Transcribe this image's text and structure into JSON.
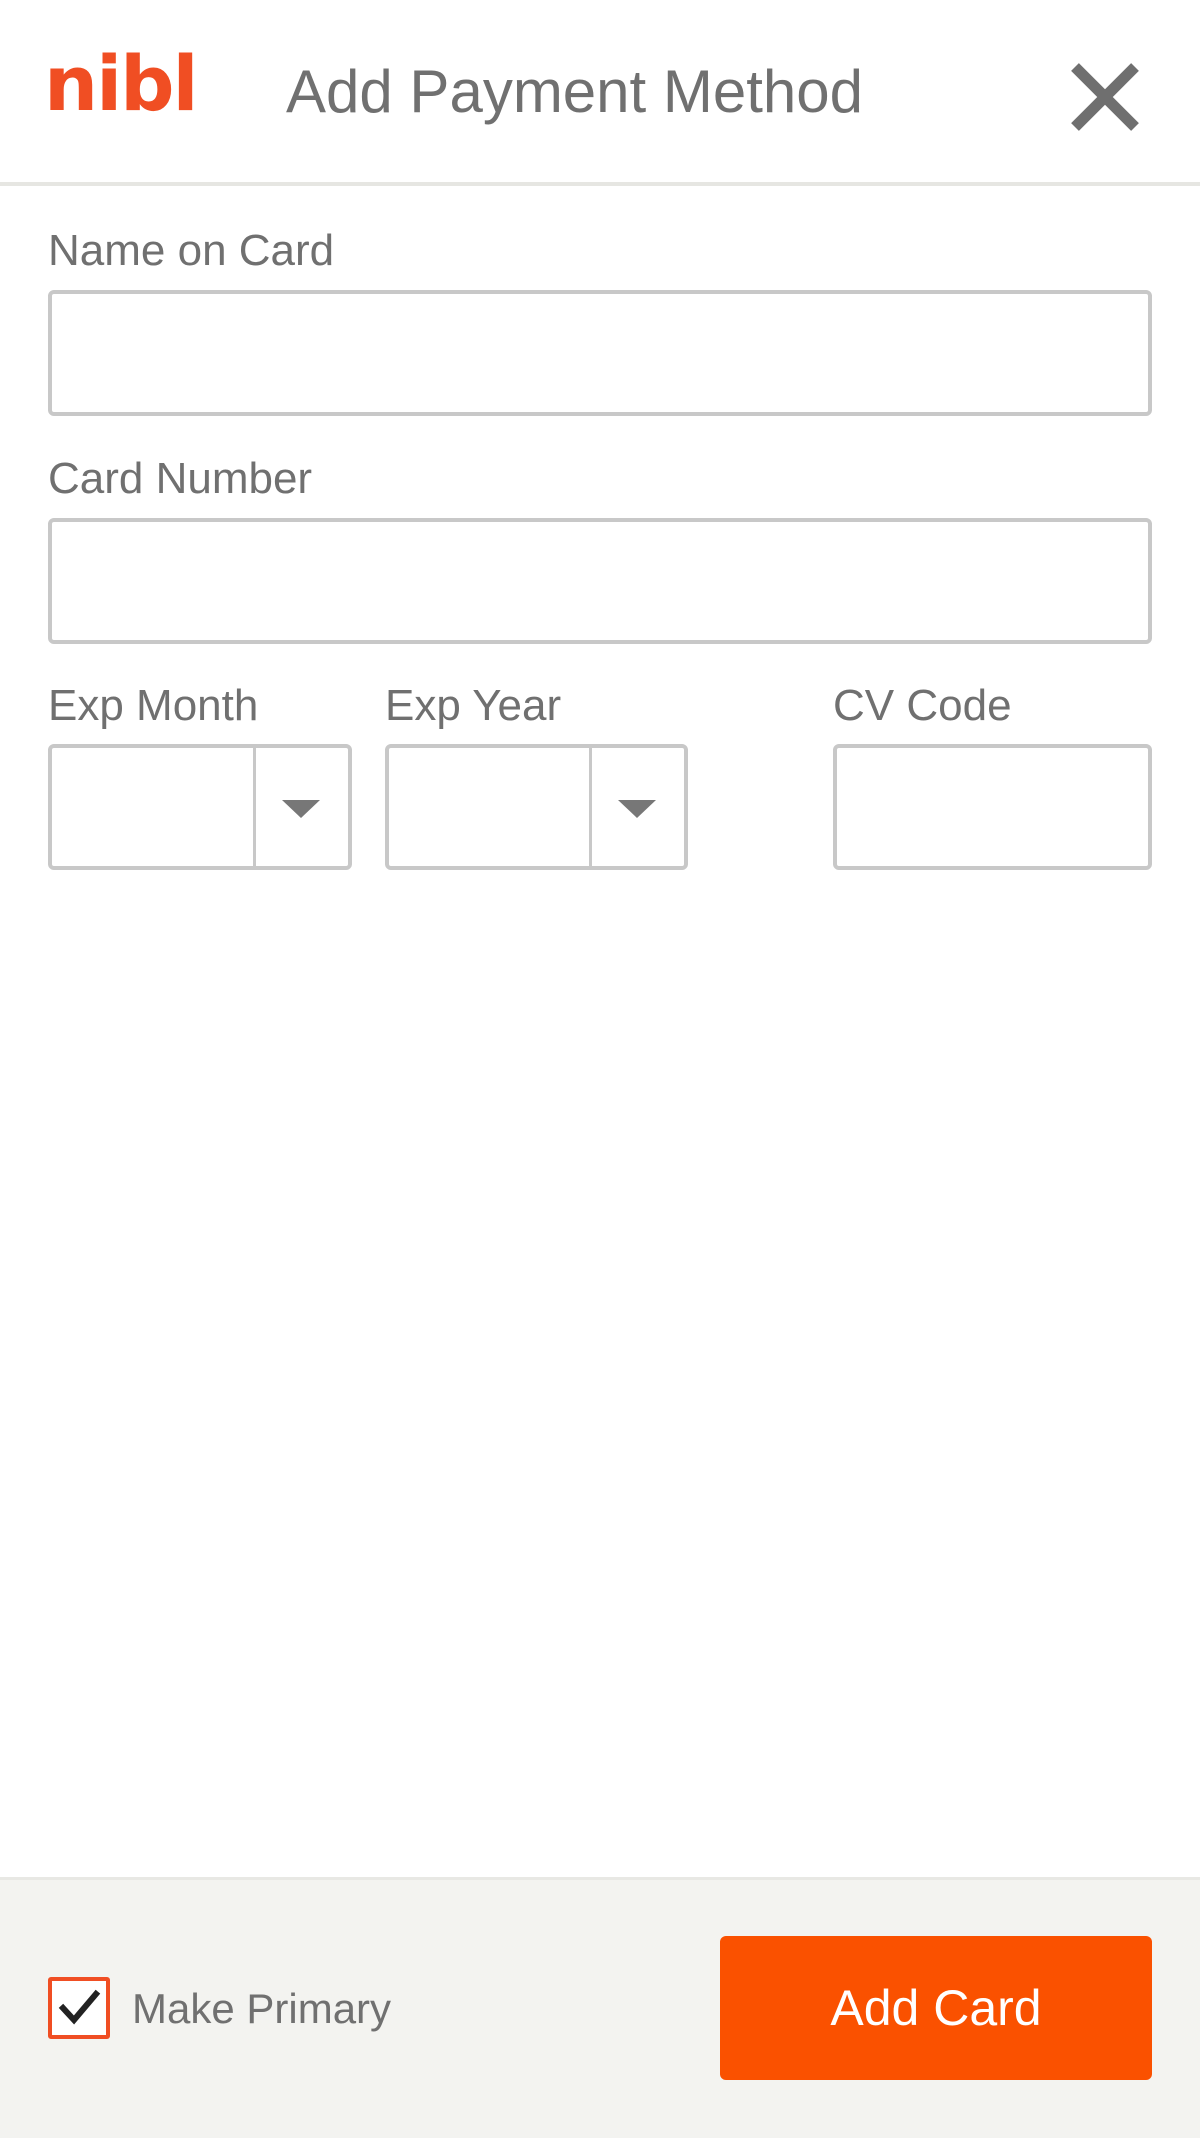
{
  "header": {
    "logo": "nibl",
    "title": "Add Payment Method"
  },
  "form": {
    "name_on_card": {
      "label": "Name on Card",
      "value": ""
    },
    "card_number": {
      "label": "Card Number",
      "value": ""
    },
    "exp_month": {
      "label": "Exp Month",
      "value": ""
    },
    "exp_year": {
      "label": "Exp Year",
      "value": ""
    },
    "cv_code": {
      "label": "CV Code",
      "value": ""
    }
  },
  "footer": {
    "make_primary_label": "Make Primary",
    "make_primary_checked": true,
    "add_card_label": "Add Card"
  },
  "colors": {
    "brand": "#f04e23",
    "button": "#fa5100",
    "text": "#707070",
    "border": "#c8c8c8",
    "footer_bg": "#f3f3f0"
  },
  "icons": {
    "close": "close-icon",
    "dropdown": "chevron-down-icon",
    "check": "checkmark-icon"
  }
}
